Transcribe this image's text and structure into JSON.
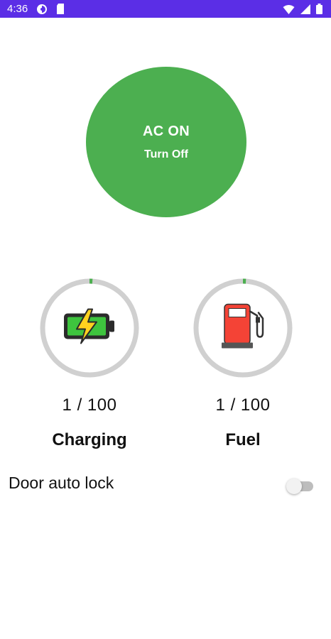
{
  "status_bar": {
    "time": "4:36",
    "left_icons": [
      "data-saver-icon",
      "sd-card-icon"
    ],
    "right_icons": [
      "wifi-icon",
      "signal-icon",
      "battery-icon"
    ],
    "background": "#5b2ee6"
  },
  "ac": {
    "title": "AC ON",
    "action": "Turn Off",
    "color": "#4caf50"
  },
  "gauges": [
    {
      "id": "charging",
      "value_text": "1 / 100",
      "label": "Charging",
      "value": 1,
      "max": 100,
      "icon": "battery-charging-icon"
    },
    {
      "id": "fuel",
      "value_text": "1 / 100",
      "label": "Fuel",
      "value": 1,
      "max": 100,
      "icon": "fuel-pump-icon"
    }
  ],
  "gauge_colors": {
    "track": "#d0d0d0",
    "progress": "#4caf50"
  },
  "door_lock": {
    "label": "Door auto lock",
    "enabled": false
  }
}
